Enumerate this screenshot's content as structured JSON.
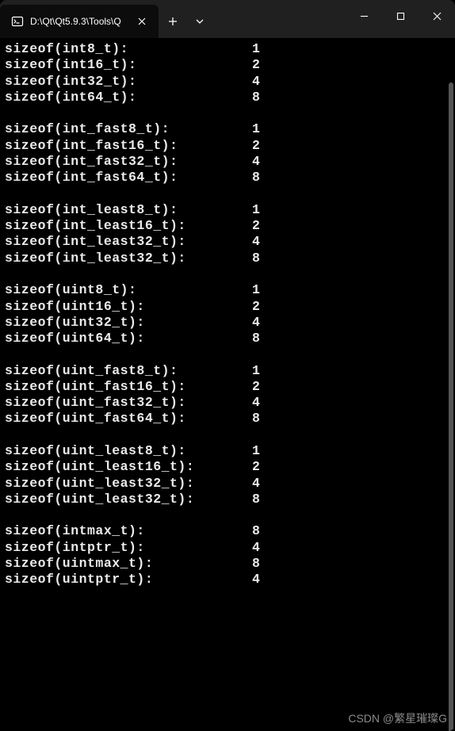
{
  "titlebar": {
    "tab_title": "D:\\Qt\\Qt5.9.3\\Tools\\Q",
    "tab_icon": "terminal-icon"
  },
  "output": {
    "label_col_width": 30,
    "groups": [
      [
        {
          "label": "sizeof(int8_t):",
          "value": "1"
        },
        {
          "label": "sizeof(int16_t):",
          "value": "2"
        },
        {
          "label": "sizeof(int32_t):",
          "value": "4"
        },
        {
          "label": "sizeof(int64_t):",
          "value": "8"
        }
      ],
      [
        {
          "label": "sizeof(int_fast8_t):",
          "value": "1"
        },
        {
          "label": "sizeof(int_fast16_t):",
          "value": "2"
        },
        {
          "label": "sizeof(int_fast32_t):",
          "value": "4"
        },
        {
          "label": "sizeof(int_fast64_t):",
          "value": "8"
        }
      ],
      [
        {
          "label": "sizeof(int_least8_t):",
          "value": "1"
        },
        {
          "label": "sizeof(int_least16_t):",
          "value": "2"
        },
        {
          "label": "sizeof(int_least32_t):",
          "value": "4"
        },
        {
          "label": "sizeof(int_least32_t):",
          "value": "8"
        }
      ],
      [
        {
          "label": "sizeof(uint8_t):",
          "value": "1"
        },
        {
          "label": "sizeof(uint16_t):",
          "value": "2"
        },
        {
          "label": "sizeof(uint32_t):",
          "value": "4"
        },
        {
          "label": "sizeof(uint64_t):",
          "value": "8"
        }
      ],
      [
        {
          "label": "sizeof(uint_fast8_t):",
          "value": "1"
        },
        {
          "label": "sizeof(uint_fast16_t):",
          "value": "2"
        },
        {
          "label": "sizeof(uint_fast32_t):",
          "value": "4"
        },
        {
          "label": "sizeof(uint_fast64_t):",
          "value": "8"
        }
      ],
      [
        {
          "label": "sizeof(uint_least8_t):",
          "value": "1"
        },
        {
          "label": "sizeof(uint_least16_t):",
          "value": "2"
        },
        {
          "label": "sizeof(uint_least32_t):",
          "value": "4"
        },
        {
          "label": "sizeof(uint_least32_t):",
          "value": "8"
        }
      ],
      [
        {
          "label": "sizeof(intmax_t):",
          "value": "8"
        },
        {
          "label": "sizeof(intptr_t):",
          "value": "4"
        },
        {
          "label": "sizeof(uintmax_t):",
          "value": "8"
        },
        {
          "label": "sizeof(uintptr_t):",
          "value": "4"
        }
      ]
    ]
  },
  "watermark": "CSDN @繁星璀璨G"
}
